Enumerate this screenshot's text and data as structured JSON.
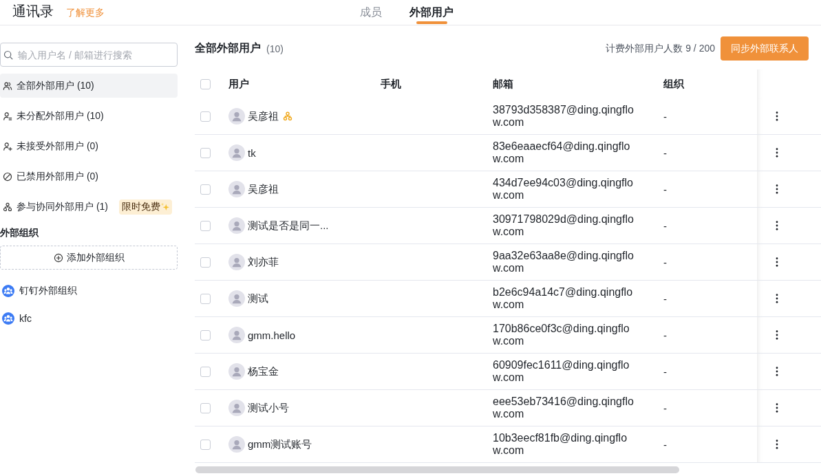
{
  "header": {
    "title": "通讯录",
    "learn_more": "了解更多"
  },
  "tabs": [
    {
      "label": "成员",
      "selected": false
    },
    {
      "label": "外部用户",
      "selected": true
    }
  ],
  "sidebar": {
    "search": {
      "placeholder": "输入用户名 / 邮箱进行搜索"
    },
    "items": [
      {
        "kind": "all",
        "label": "全部外部用户 (10)",
        "selected": true
      },
      {
        "kind": "unassigned",
        "label": "未分配外部用户 (10)",
        "selected": false
      },
      {
        "kind": "pending",
        "label": "未接受外部用户 (0)",
        "selected": false
      },
      {
        "kind": "disabled",
        "label": "已禁用外部用户 (0)",
        "selected": false
      },
      {
        "kind": "collaborative",
        "label": "参与协同外部用户 (1)",
        "selected": false,
        "badge": "限时免费"
      }
    ],
    "orgs_heading": "外部组织",
    "add_org": "添加外部组织",
    "orgs": [
      {
        "name": "钉钉外部组织",
        "selected": false
      },
      {
        "name": "kfc",
        "selected": false
      }
    ]
  },
  "main": {
    "title": "全部外部用户",
    "count": "(10)",
    "quota": "计费外部用户人数 9 / 200",
    "sync_button": "同步外部联系人"
  },
  "table": {
    "all_checked": false,
    "columns": [
      "用户",
      "手机",
      "邮箱",
      "组织"
    ],
    "rows": [
      {
        "checked": false,
        "name": "吴彦祖",
        "collaborative": true,
        "email": "38793d358387@ding.qingflow.com",
        "org": "-"
      },
      {
        "checked": false,
        "name": "tk",
        "collaborative": false,
        "email": "83e6eaaecf64@ding.qingflow.com",
        "org": "-"
      },
      {
        "checked": false,
        "name": "吴彦祖",
        "collaborative": false,
        "email": "434d7ee94c03@ding.qingflow.com",
        "org": "-"
      },
      {
        "checked": false,
        "name": "测试是否是同一...",
        "collaborative": false,
        "email": "30971798029d@ding.qingflow.com",
        "org": "-"
      },
      {
        "checked": false,
        "name": "刘亦菲",
        "collaborative": false,
        "email": "9aa32e63aa8e@ding.qingflow.com",
        "org": "-"
      },
      {
        "checked": false,
        "name": "测试",
        "collaborative": false,
        "email": "b2e6c94a14c7@ding.qingflow.com",
        "org": "-"
      },
      {
        "checked": false,
        "name": "gmm.hello",
        "collaborative": false,
        "email": "170b86ce0f3c@ding.qingflow.com",
        "org": "-"
      },
      {
        "checked": false,
        "name": "杨宝金",
        "collaborative": false,
        "email": "60909fec1611@ding.qingflow.com",
        "org": "-"
      },
      {
        "checked": false,
        "name": "测试小号",
        "collaborative": false,
        "email": "eee53eb73416@ding.qingflow.com",
        "org": "-"
      },
      {
        "checked": false,
        "name": "gmm测试账号",
        "collaborative": false,
        "email": "10b3eecf81fb@ding.qingflow.com",
        "org": "-"
      }
    ]
  }
}
